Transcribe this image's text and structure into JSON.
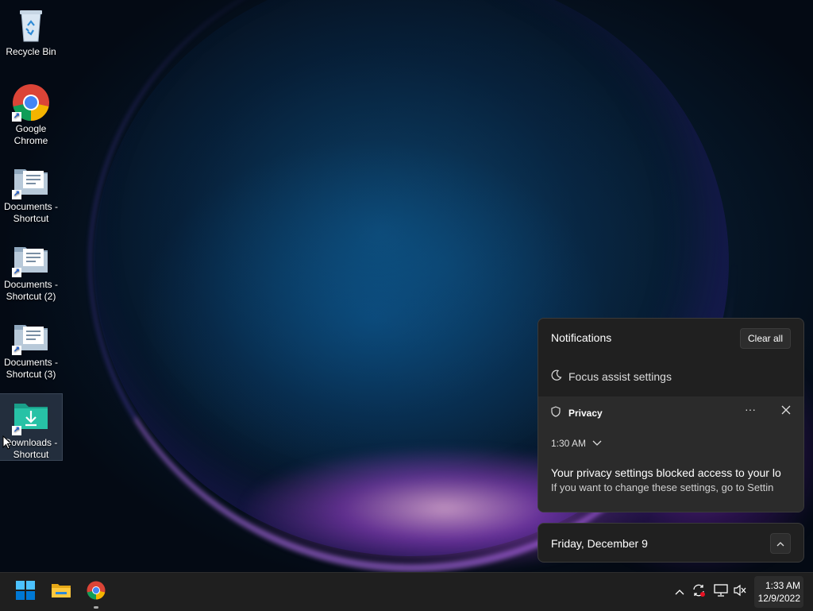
{
  "desktop": {
    "icons": [
      {
        "label": "Recycle Bin"
      },
      {
        "label": "Google Chrome"
      },
      {
        "label": "Documents - Shortcut"
      },
      {
        "label": "Documents - Shortcut (2)"
      },
      {
        "label": "Documents - Shortcut (3)"
      },
      {
        "label": "Downloads - Shortcut"
      }
    ]
  },
  "notifications": {
    "title": "Notifications",
    "clear_all": "Clear all",
    "focus_assist": "Focus assist settings",
    "card": {
      "app": "Privacy",
      "time": "1:30 AM",
      "title": "Your privacy settings blocked access to your locat",
      "body": "If you want to change these settings, go to Settin"
    }
  },
  "calendar": {
    "date": "Friday, December 9"
  },
  "taskbar": {
    "clock_time": "1:33 AM",
    "clock_date": "12/9/2022"
  },
  "colors": {
    "panel_bg": "#202020",
    "card_bg": "#2b2b2b",
    "taskbar_bg": "#1f1f1f",
    "accent_start": "#0078d4"
  }
}
